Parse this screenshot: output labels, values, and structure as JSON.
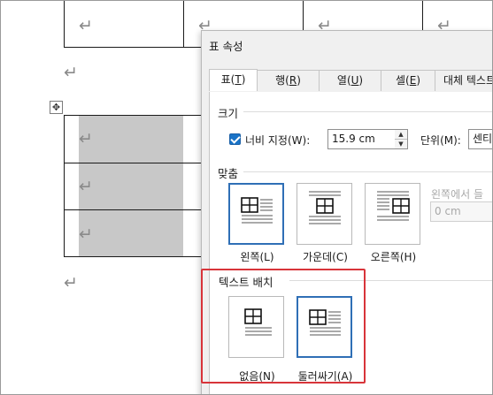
{
  "document": {
    "return_glyph": "↵"
  },
  "dialog": {
    "title": "표 속성",
    "tabs": [
      {
        "label": "표",
        "key": "T",
        "active": true
      },
      {
        "label": "행",
        "key": "R",
        "active": false
      },
      {
        "label": "열",
        "key": "U",
        "active": false
      },
      {
        "label": "셀",
        "key": "E",
        "active": false
      },
      {
        "label": "대체 텍스트",
        "key": "",
        "active": false
      }
    ],
    "size": {
      "section_label": "크기",
      "width_checkbox_label": "너비 지정(W):",
      "width_checked": true,
      "width_value": "15.9 cm",
      "unit_label": "단위(M):",
      "unit_value": "센티"
    },
    "alignment": {
      "section_label": "맞춤",
      "options": [
        {
          "label": "왼쪽(L)",
          "selected": true
        },
        {
          "label": "가운데(C)",
          "selected": false
        },
        {
          "label": "오른쪽(H)",
          "selected": false
        }
      ],
      "indent_label": "왼쪽에서 들",
      "indent_value": "0 cm"
    },
    "text_wrap": {
      "section_label": "텍스트 배치",
      "options": [
        {
          "label": "없음(N)",
          "selected": false
        },
        {
          "label": "둘러싸기(A)",
          "selected": true
        }
      ]
    }
  },
  "colors": {
    "accent_blue": "#2f6fb6",
    "highlight_red": "#d8343a",
    "shade_gray": "#c8c8c8"
  }
}
